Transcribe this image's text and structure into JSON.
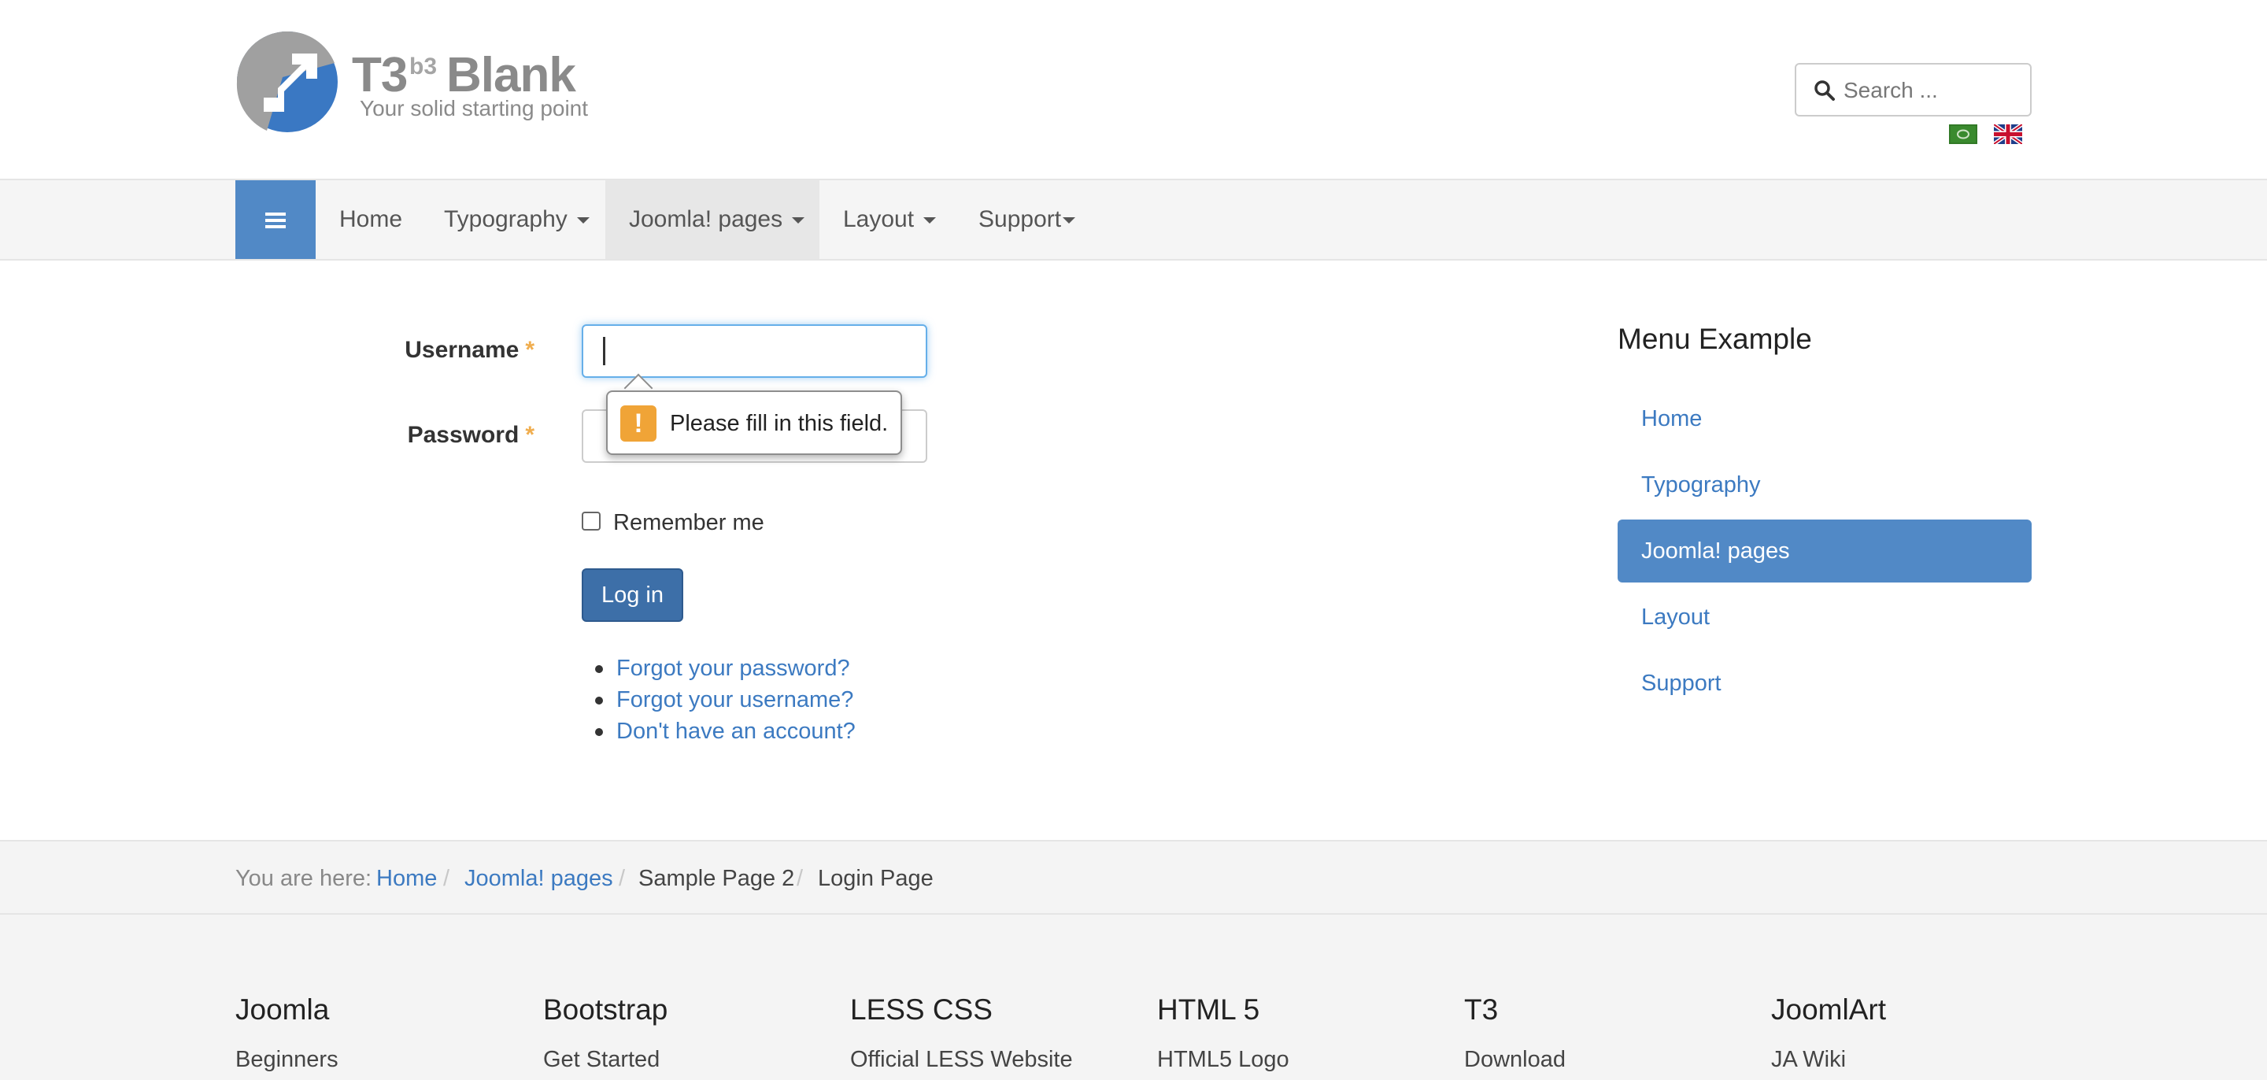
{
  "header": {
    "logo": {
      "main": "T3",
      "sup": "b3",
      "name": "Blank",
      "slogan": "Your solid starting point"
    },
    "search": {
      "placeholder": "Search ..."
    },
    "languages": [
      "arabic-flag",
      "english-flag"
    ]
  },
  "nav": {
    "items": [
      {
        "label": "Home"
      },
      {
        "label": "Typography"
      },
      {
        "label": "Joomla! pages"
      },
      {
        "label": "Layout"
      },
      {
        "label": "Support"
      }
    ]
  },
  "login": {
    "username_label": "Username",
    "password_label": "Password",
    "required_mark": "*",
    "username_value": "",
    "validation_message": "Please fill in this field.",
    "remember_label": "Remember me",
    "remember_checked": false,
    "submit_label": "Log in",
    "links": [
      "Forgot your password?",
      "Forgot your username?",
      "Don't have an account?"
    ]
  },
  "sidebar": {
    "title": "Menu Example",
    "items": [
      {
        "label": "Home"
      },
      {
        "label": "Typography"
      },
      {
        "label": "Joomla! pages"
      },
      {
        "label": "Layout"
      },
      {
        "label": "Support"
      }
    ]
  },
  "breadcrumb": {
    "prefix": "You are here:",
    "separator": "/",
    "items": [
      "Home",
      "Joomla! pages",
      "Sample Page 2",
      "Login Page"
    ]
  },
  "footer": {
    "columns": [
      {
        "heading": "Joomla",
        "link": "Beginners"
      },
      {
        "heading": "Bootstrap",
        "link": "Get Started"
      },
      {
        "heading": "LESS CSS",
        "link": "Official LESS Website"
      },
      {
        "heading": "HTML 5",
        "link": "HTML5 Logo"
      },
      {
        "heading": "T3",
        "link": "Download"
      },
      {
        "heading": "JoomlArt",
        "link": "JA Wiki"
      }
    ]
  },
  "colors": {
    "accent": "#5189c6",
    "link": "#3c7ac1",
    "button": "#3d6fa8",
    "required": "#f0ad4e",
    "warning": "#f0a437"
  }
}
